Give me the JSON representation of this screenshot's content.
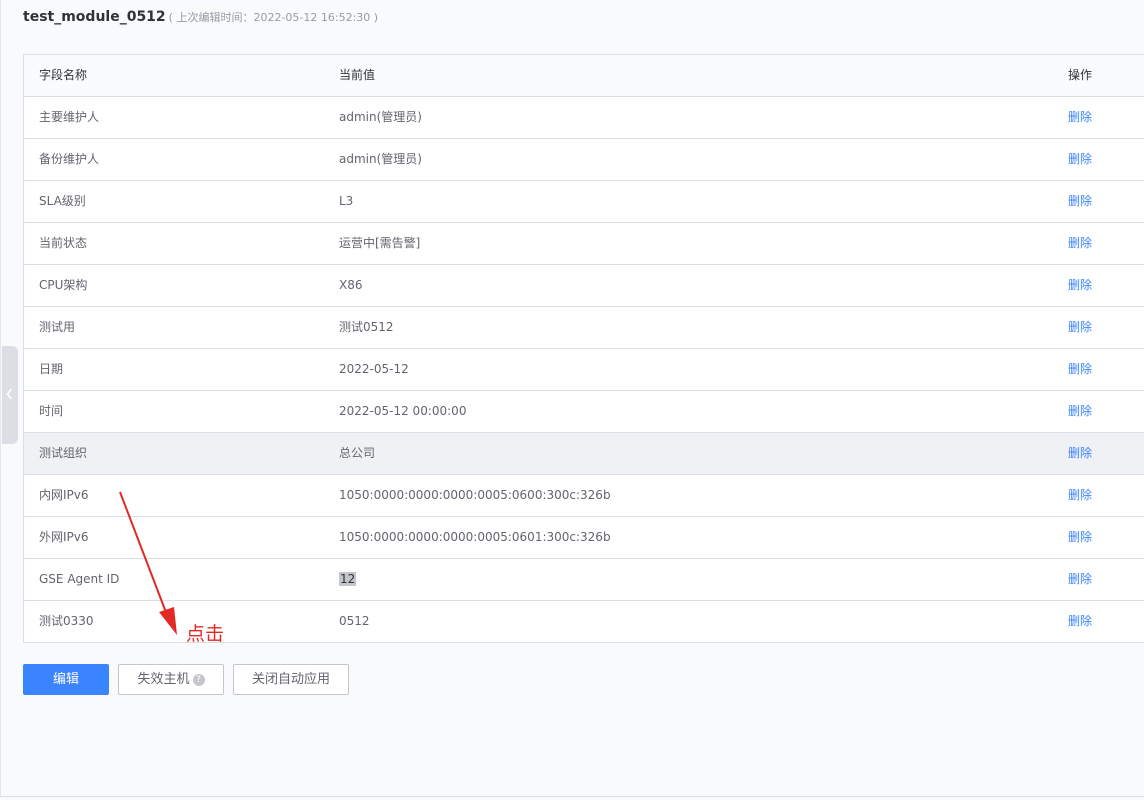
{
  "header": {
    "title": "test_module_0512",
    "subtitle": "( 上次编辑时间：2022-05-12 16:52:30 )"
  },
  "table": {
    "columns": [
      "字段名称",
      "当前值",
      "操作"
    ],
    "rows": [
      {
        "field": "主要维护人",
        "value": "admin(管理员)",
        "action": "删除"
      },
      {
        "field": "备份维护人",
        "value": "admin(管理员)",
        "action": "删除"
      },
      {
        "field": "SLA级别",
        "value": "L3",
        "action": "删除"
      },
      {
        "field": "当前状态",
        "value": "运营中[需告警]",
        "action": "删除"
      },
      {
        "field": "CPU架构",
        "value": "X86",
        "action": "删除"
      },
      {
        "field": "测试用",
        "value": "测试0512",
        "action": "删除"
      },
      {
        "field": "日期",
        "value": "2022-05-12",
        "action": "删除"
      },
      {
        "field": "时间",
        "value": "2022-05-12 00:00:00",
        "action": "删除"
      },
      {
        "field": "测试组织",
        "value": "总公司",
        "action": "删除"
      },
      {
        "field": "内网IPv6",
        "value": "1050:0000:0000:0000:0005:0600:300c:326b",
        "action": "删除"
      },
      {
        "field": "外网IPv6",
        "value": "1050:0000:0000:0000:0005:0601:300c:326b",
        "action": "删除"
      },
      {
        "field": "GSE Agent ID",
        "value": "12",
        "action": "删除"
      },
      {
        "field": "测试0330",
        "value": "0512",
        "action": "删除"
      }
    ]
  },
  "buttons": {
    "edit": "编辑",
    "disable_host": "失效主机",
    "disable_host_badge": "?",
    "auto_apply": "关闭自动应用"
  },
  "annotation": {
    "text": "点击",
    "color": "#e22a24"
  },
  "colors": {
    "primary": "#3a84ff",
    "hover_row": "#f0f1f5"
  }
}
